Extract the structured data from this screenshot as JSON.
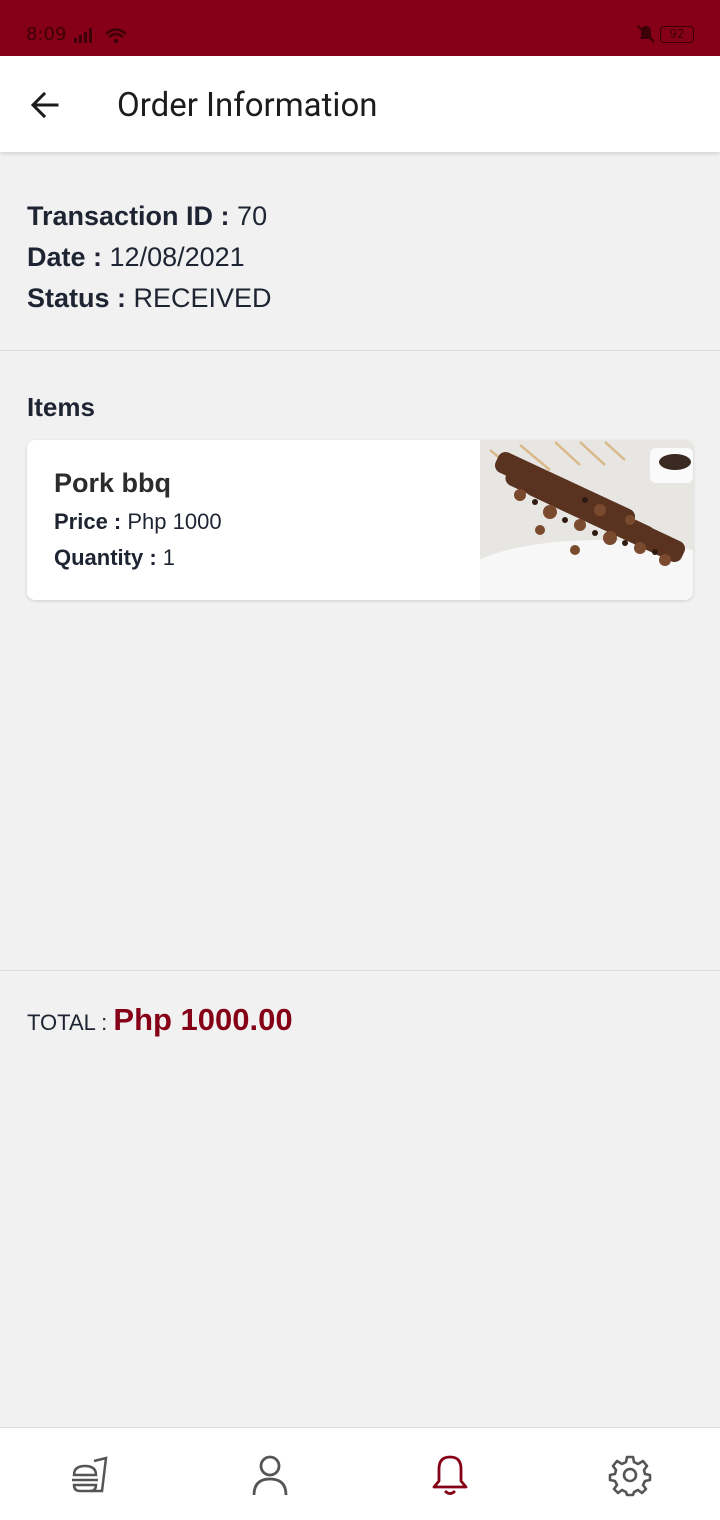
{
  "status_bar": {
    "time": "8:09",
    "battery": "92"
  },
  "header": {
    "title": "Order Information"
  },
  "order": {
    "transaction_label": "Transaction ID : ",
    "transaction_id": "70",
    "date_label": "Date : ",
    "date": "12/08/2021",
    "status_label": "Status : ",
    "status": "RECEIVED"
  },
  "items_heading": "Items",
  "items": [
    {
      "name": "Pork bbq",
      "price_label": "Price : ",
      "price": "Php 1000",
      "quantity_label": "Quantity : ",
      "quantity": "1"
    }
  ],
  "total": {
    "label": "TOTAL : ",
    "amount": "Php 1000.00"
  },
  "bottom_nav": [
    {
      "icon": "food-icon",
      "active": false
    },
    {
      "icon": "profile-icon",
      "active": false
    },
    {
      "icon": "bell-icon",
      "active": true
    },
    {
      "icon": "gear-icon",
      "active": false
    }
  ],
  "colors": {
    "primary": "#850016",
    "background": "#f1f1f1",
    "text": "#1f2433"
  }
}
